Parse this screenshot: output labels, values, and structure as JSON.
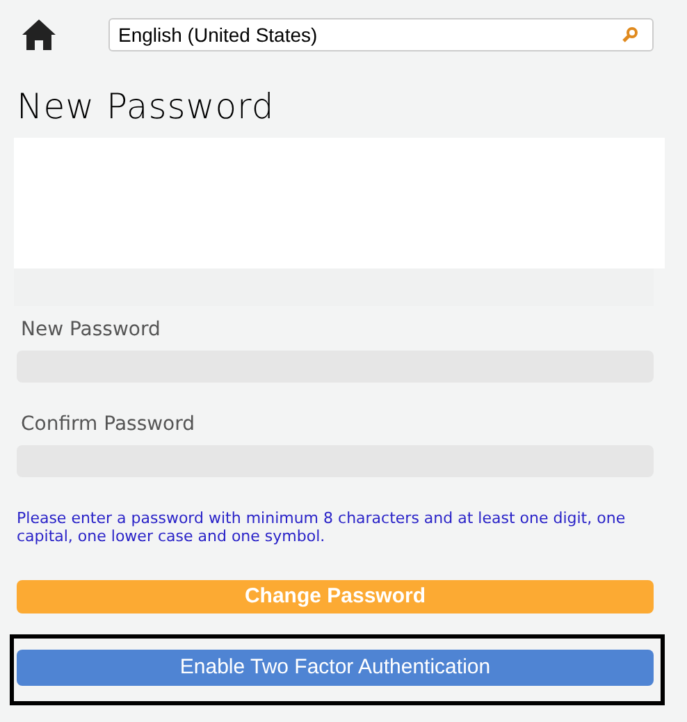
{
  "language_select": {
    "value": "English (United States)"
  },
  "title": "New Password",
  "fields": [
    {
      "label": "New Password"
    },
    {
      "label": "Confirm Password"
    }
  ],
  "hint": "Please enter a password with minimum 8 characters and at least one digit, one capital, one lower case and one symbol.",
  "buttons": [
    {
      "label": "Change Password",
      "kind": "primary",
      "highlighted": false
    },
    {
      "label": "Enable Two Factor Authentication",
      "kind": "secondary",
      "highlighted": true
    }
  ]
}
